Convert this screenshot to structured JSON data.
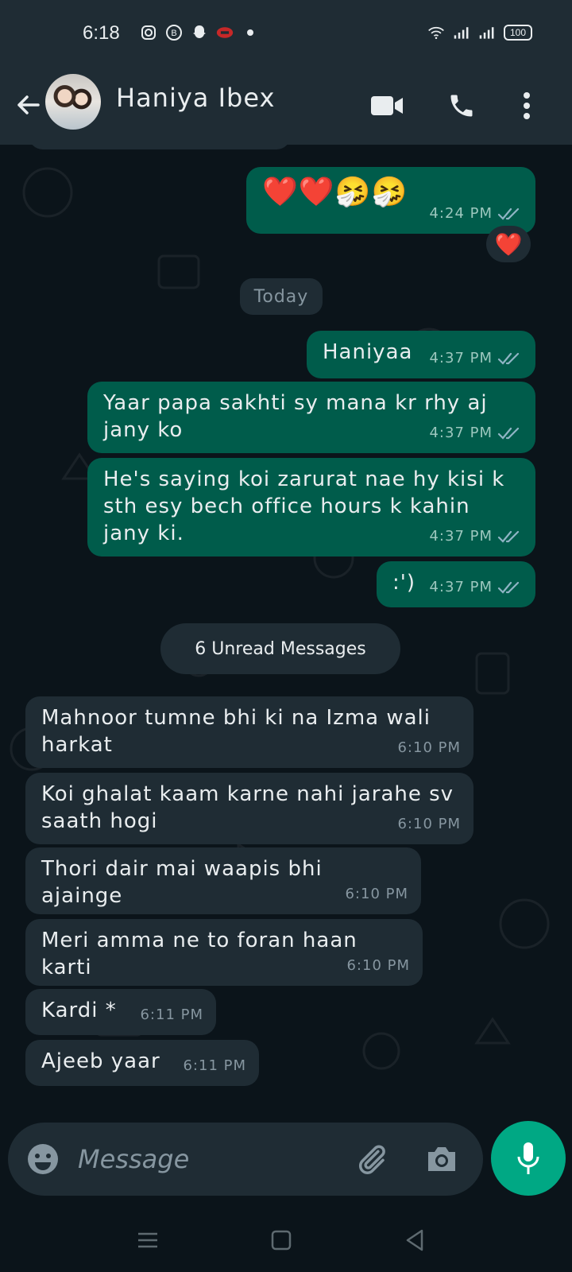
{
  "status_bar": {
    "time": "6:18",
    "battery": "100",
    "left_icons": [
      "instagram-icon",
      "b-icon",
      "snapchat-icon",
      "game-icon",
      "dot-icon"
    ],
    "right_icons": [
      "wifi-icon",
      "signal-icon",
      "signal-icon-2",
      "battery-icon"
    ]
  },
  "header": {
    "contact_name": "Haniya Ibex",
    "icons": [
      "back-arrow-icon",
      "avatar",
      "video-call-icon",
      "phone-icon",
      "more-vert-icon"
    ]
  },
  "messages_top": [
    {
      "type": "out",
      "emoji": "❤️❤️🤧🤧",
      "time": "4:24 PM",
      "reaction": "❤️"
    }
  ],
  "date_divider": "Today",
  "outgoing": [
    {
      "text": "Haniyaa",
      "time": "4:37 PM"
    },
    {
      "text": "Yaar papa sakhti sy mana kr rhy aj jany ko",
      "time": "4:37 PM"
    },
    {
      "text": "He's saying koi zarurat nae hy kisi k sth esy bech  office hours k kahin jany ki.",
      "time": "4:37 PM"
    },
    {
      "text": ":')",
      "time": "4:37 PM"
    }
  ],
  "unread_label": "6 Unread Messages",
  "incoming": [
    {
      "text": "Mahnoor tumne bhi ki na Izma wali harkat",
      "time": "6:10 PM"
    },
    {
      "text": "Koi ghalat kaam karne nahi jarahe sv saath hogi",
      "time": "6:10 PM"
    },
    {
      "text": "Thori dair mai waapis bhi ajainge",
      "time": "6:10 PM"
    },
    {
      "text": "Meri amma ne to foran haan karti",
      "time": "6:10 PM"
    },
    {
      "text": "Kardi *",
      "time": "6:11 PM"
    },
    {
      "text": "Ajeeb yaar",
      "time": "6:11 PM"
    }
  ],
  "composer": {
    "placeholder": "Message"
  },
  "colors": {
    "background": "#0b141a",
    "header": "#1f2c34",
    "outgoing_bubble": "#005c4b",
    "incoming_bubble": "#1f2c34",
    "accent": "#00a884"
  }
}
